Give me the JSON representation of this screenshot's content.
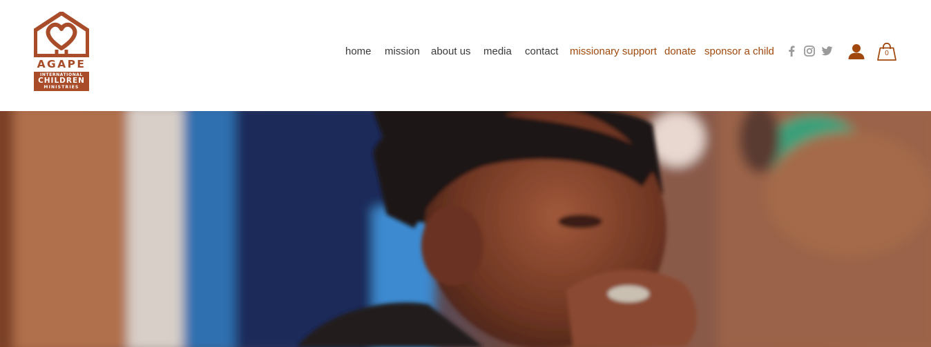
{
  "logo": {
    "wordmark": "AGAPE",
    "line1": "INTERNATIONAL",
    "line2": "CHILDREN",
    "line3": "MINISTRIES",
    "brand_color": "#a84c2a"
  },
  "nav": {
    "items": [
      {
        "label": "home"
      },
      {
        "label": "mission"
      },
      {
        "label": "about us"
      },
      {
        "label": "media"
      },
      {
        "label": "contact"
      },
      {
        "label": "missionary support"
      },
      {
        "label": "donate"
      },
      {
        "label": "sponsor a child"
      }
    ],
    "text_color": "#3a3a3a",
    "accent_color": "#a0480d"
  },
  "social": {
    "icons": [
      "facebook-icon",
      "instagram-icon",
      "twitter-icon"
    ],
    "color": "#9a9a9a"
  },
  "account": {
    "icon": "user-icon"
  },
  "cart": {
    "icon": "shopping-bag-icon",
    "count": "0"
  },
  "hero": {
    "image_subject": "child eating"
  }
}
